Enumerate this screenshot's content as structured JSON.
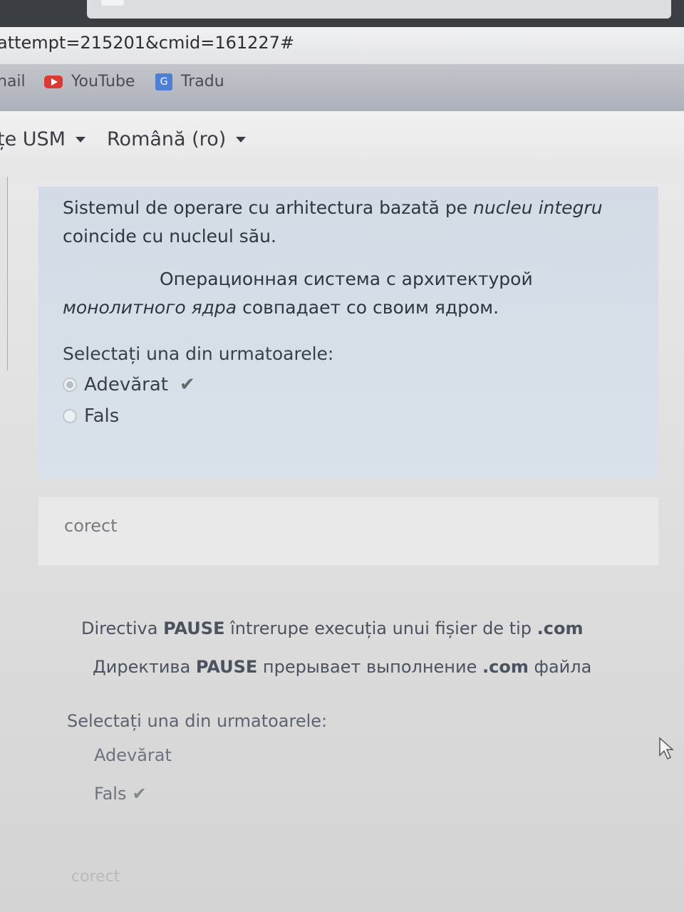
{
  "browser": {
    "url": "attempt=215201&cmid=161227#",
    "bookmarks": [
      {
        "label": "nail",
        "icon": "mail-icon"
      },
      {
        "label": "YouTube",
        "icon": "youtube-icon"
      },
      {
        "label": "Tradu",
        "icon": "google-translate-icon"
      }
    ]
  },
  "header": {
    "site_menu": "țe USM",
    "language_menu": "Română (ro)"
  },
  "question1": {
    "text_ro_a": "Sistemul de operare cu arhitectura bazată pe ",
    "text_ro_em": "nucleu integru",
    "text_ro_b": " coincide cu nucleul său.",
    "text_ru_a": "Операционная система с архитектурой ",
    "text_ru_em": "монолитного ядра",
    "text_ru_b": " совпадает со своим ядром.",
    "prompt": "Selectați una din urmatoarele:",
    "options": [
      {
        "label": "Adevărat",
        "selected": true,
        "correct": true
      },
      {
        "label": "Fals",
        "selected": false,
        "correct": false
      }
    ],
    "feedback": "corect"
  },
  "question2": {
    "ro_a": "Directiva ",
    "ro_b1": "PAUSE",
    "ro_c": " întrerupe execuția unui fișier de tip ",
    "ro_d": ".com",
    "ru_a": "Директива ",
    "ru_b1": "PAUSE",
    "ru_c": " прерывает выполнение ",
    "ru_d": ".com",
    "ru_e": " файла",
    "prompt": "Selectați una din urmatoarele:",
    "options": [
      {
        "label": "Adevărat",
        "selected": false,
        "correct": false
      },
      {
        "label": "Fals",
        "selected": true,
        "correct": true
      }
    ],
    "feedback": "corect"
  },
  "colors": {
    "question_bg": "#d6dee8",
    "check": "#5f6b67"
  }
}
